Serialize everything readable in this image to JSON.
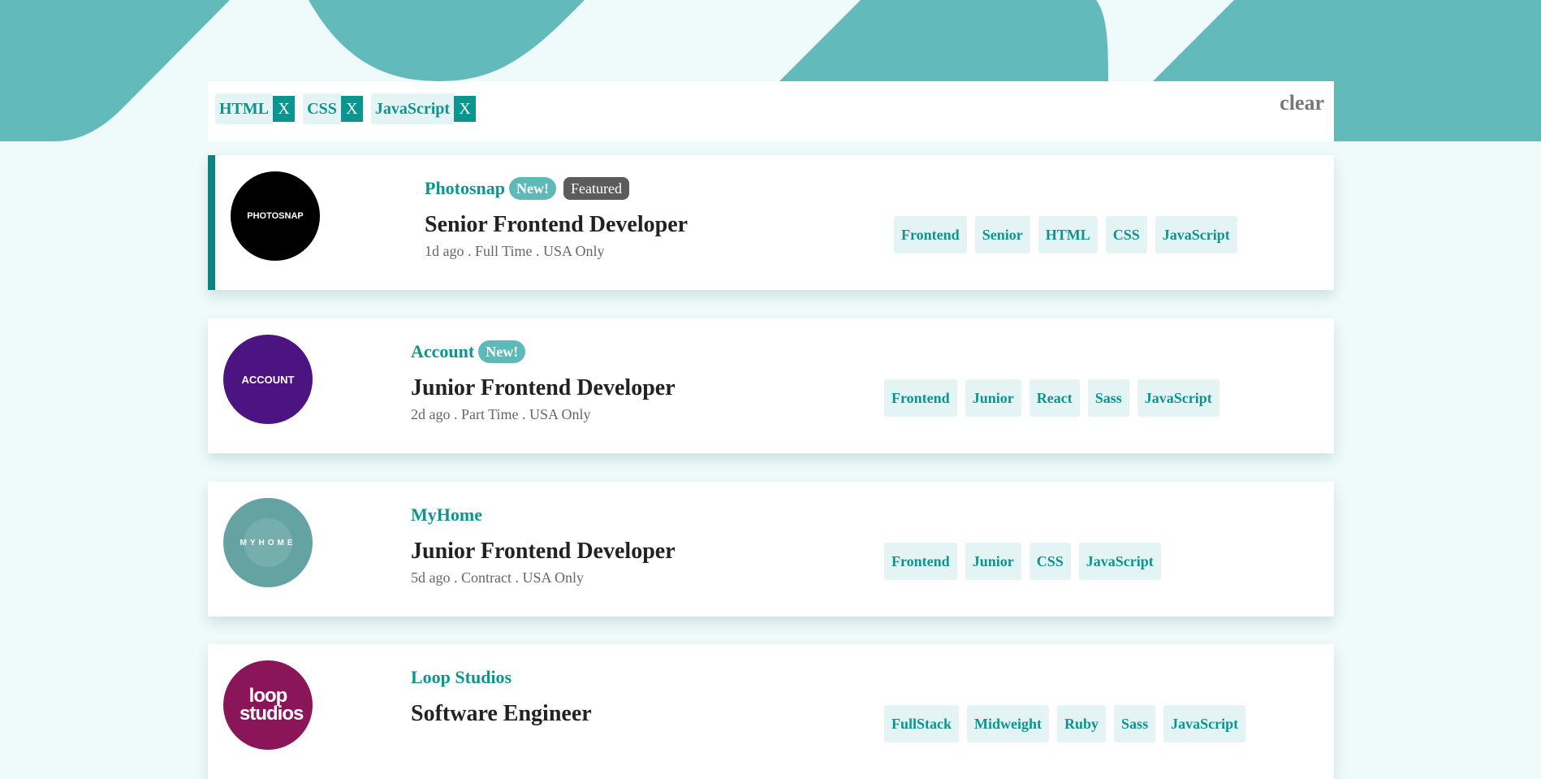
{
  "colors": {
    "background": "#effafa",
    "hero": "#63babb",
    "accent": "#0b9590",
    "tag_bg": "#e4f4f4",
    "new_badge": "#5ebab8",
    "featured_badge": "#5c5c5c"
  },
  "filters": {
    "items": [
      {
        "label": "HTML",
        "remove": "X"
      },
      {
        "label": "CSS",
        "remove": "X"
      },
      {
        "label": "JavaScript",
        "remove": "X"
      }
    ],
    "clear_label": "clear"
  },
  "jobs": [
    {
      "company": "Photosnap",
      "logo_text": "PHOTOSNAP",
      "logo_color": "#000000",
      "new_label": "New!",
      "featured_label": "Featured",
      "position": "Senior Frontend Developer",
      "meta": "1d ago . Full Time . USA Only",
      "tags": [
        "Frontend",
        "Senior",
        "HTML",
        "CSS",
        "JavaScript"
      ]
    },
    {
      "company": "Account",
      "logo_text": "ACCOUNT",
      "logo_color": "#4b1481",
      "new_label": "New!",
      "position": "Junior Frontend Developer",
      "meta": "2d ago . Part Time . USA Only",
      "tags": [
        "Frontend",
        "Junior",
        "React",
        "Sass",
        "JavaScript"
      ]
    },
    {
      "company": "MyHome",
      "logo_text": "MYHOME",
      "logo_color": "#64a3a2",
      "position": "Junior Frontend Developer",
      "meta": "5d ago . Contract . USA Only",
      "tags": [
        "Frontend",
        "Junior",
        "CSS",
        "JavaScript"
      ]
    },
    {
      "company": "Loop Studios",
      "logo_text": "loop studios",
      "logo_color": "#8b1559",
      "position": "Software Engineer",
      "tags": [
        "FullStack",
        "Midweight",
        "Ruby",
        "Sass",
        "JavaScript"
      ]
    }
  ]
}
